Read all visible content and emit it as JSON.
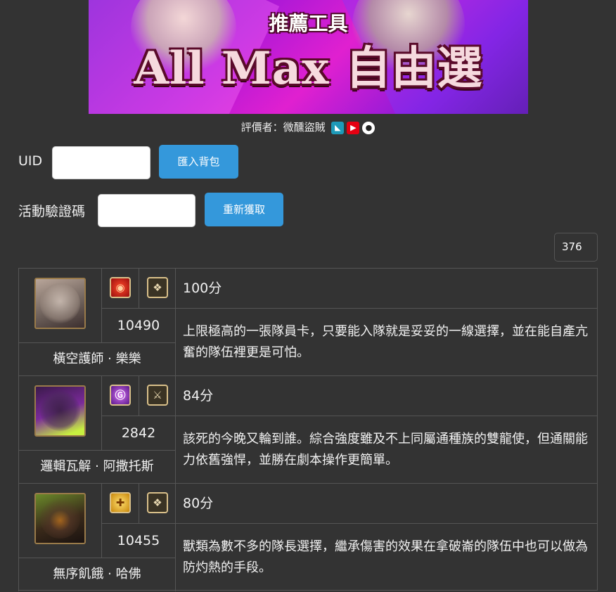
{
  "banner": {
    "subtitle": "推薦工具",
    "title": "All Max 自由選"
  },
  "reviewer": {
    "text": "評價者：微醺盜賊",
    "icons": [
      "bahamut-icon",
      "youtube-icon",
      "github-icon"
    ]
  },
  "form": {
    "uid_label": "UID",
    "uid_value": "",
    "import_button": "匯入背包",
    "code_label": "活動驗證碼",
    "code_value": "",
    "refresh_button": "重新獲取",
    "count": "376"
  },
  "colors": {
    "accent": "#3498db",
    "background": "#333333",
    "border": "#555555"
  },
  "cards": [
    {
      "score": "100分",
      "id": "10490",
      "name": "橫空護師 · 樂樂",
      "attribute": "fire",
      "race": "beast",
      "description": "上限極高的一張隊員卡，只要能入隊就是妥妥的一線選擇，並在能自產亢奮的隊伍裡更是可怕。"
    },
    {
      "score": "84分",
      "id": "2842",
      "name": "邏輯瓦解 · 阿撒托斯",
      "attribute": "dark",
      "race": "dragon",
      "description": "該死的今晚又輪到誰。綜合強度雖及不上同屬通種族的雙龍使，但通關能力依舊強悍，並勝在劇本操作更簡單。"
    },
    {
      "score": "80分",
      "id": "10455",
      "name": "無序飢餓 · 哈佛",
      "attribute": "light",
      "race": "beast",
      "description": "獸類為數不多的隊長選擇，繼承傷害的效果在拿破崙的隊伍中也可以做為防灼熱的手段。"
    }
  ]
}
